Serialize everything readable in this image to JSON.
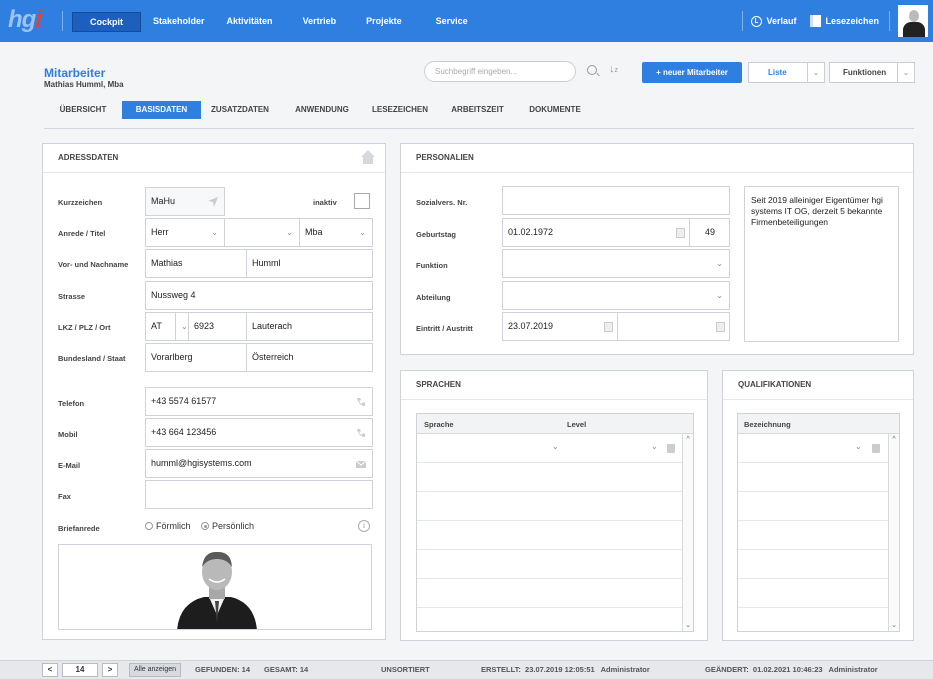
{
  "nav": {
    "logo": "hg",
    "logo_accent": "i",
    "items": [
      "Cockpit",
      "Stakeholder",
      "Aktivitäten",
      "Vertrieb",
      "Projekte",
      "Service"
    ],
    "verlauf": "Verlauf",
    "lesezeichen": "Lesezeichen"
  },
  "header": {
    "title": "Mitarbeiter",
    "subtitle": "Mathias Humml, Mba",
    "search_placeholder": "Suchbegriff eingeben...",
    "new_button": "+ neuer Mitarbeiter",
    "list_button": "Liste",
    "functions_button": "Funktionen"
  },
  "tabs": [
    "ÜBERSICHT",
    "BASISDATEN",
    "ZUSATZDATEN",
    "ANWENDUNG",
    "LESEZEICHEN",
    "ARBEITSZEIT",
    "DOKUMENTE"
  ],
  "adressdaten": {
    "title": "ADRESSDATEN",
    "kurzzeichen_label": "Kurzzeichen",
    "kurzzeichen": "MaHu",
    "inaktiv_label": "inaktiv",
    "anrede_label": "Anrede / Titel",
    "anrede": "Herr",
    "titel_vor": "",
    "titel_nach": "Mba",
    "name_label": "Vor- und Nachname",
    "vorname": "Mathias",
    "nachname": "Humml",
    "strasse_label": "Strasse",
    "strasse": "Nussweg 4",
    "ort_label": "LKZ / PLZ / Ort",
    "lkz": "AT",
    "plz": "6923",
    "ort": "Lauterach",
    "land_label": "Bundesland / Staat",
    "bundesland": "Vorarlberg",
    "staat": "Österreich",
    "telefon_label": "Telefon",
    "telefon": "+43 5574 61577",
    "mobil_label": "Mobil",
    "mobil": "+43 664 123456",
    "email_label": "E-Mail",
    "email": "humml@hgisystems.com",
    "fax_label": "Fax",
    "fax": "",
    "briefanrede_label": "Briefanrede",
    "briefanrede_opt1": "Förmlich",
    "briefanrede_opt2": "Persönlich"
  },
  "personalien": {
    "title": "PERSONALIEN",
    "svnr_label": "Sozialvers. Nr.",
    "svnr": "",
    "geburtstag_label": "Geburtstag",
    "geburtstag": "01.02.1972",
    "alter": "49",
    "funktion_label": "Funktion",
    "funktion": "",
    "abteilung_label": "Abteilung",
    "abteilung": "",
    "eintritt_label": "Eintritt / Austritt",
    "eintritt": "23.07.2019",
    "austritt": "",
    "note": "Seit 2019 alleiniger Eigentümer hgi systems IT OG, derzeit 5 bekannte Firmenbeteiligungen"
  },
  "sprachen": {
    "title": "SPRACHEN",
    "col_sprache": "Sprache",
    "col_level": "Level"
  },
  "qualifikationen": {
    "title": "QUALIFIKATIONEN",
    "col_bezeichnung": "Bezeichnung"
  },
  "footer": {
    "page": "14",
    "show_all": "Alle anzeigen",
    "gefunden": "GEFUNDEN: 14",
    "gesamt": "GESAMT: 14",
    "sort": "UNSORTIERT",
    "erstellt": "ERSTELLT:  23.07.2019 12:05:51   Administrator",
    "geaendert": "GEÄNDERT:  01.02.2021 10:46:23   Administrator"
  },
  "colors": {
    "primary": "#2f7fe0",
    "logo_accent": "#e8402b"
  }
}
